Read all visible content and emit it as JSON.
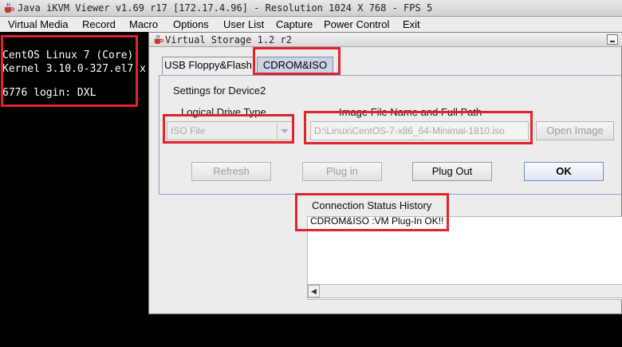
{
  "outer_window": {
    "title": "Java iKVM Viewer v1.69 r17 [172.17.4.96] - Resolution 1024 X 768 - FPS 5",
    "icon": "java-coffee-icon"
  },
  "menubar": {
    "items": [
      "Virtual Media",
      "Record",
      "Macro",
      "Options",
      "User List",
      "Capture",
      "Power Control",
      "Exit"
    ]
  },
  "console": {
    "lines": [
      "CentOS Linux 7 (Core)",
      "Kernel 3.10.0-327.el7.x",
      "6776 login: DXL"
    ]
  },
  "dialog": {
    "title": "Virtual Storage 1.2 r2",
    "tabs": [
      {
        "label": "USB Floppy&Flash",
        "active": false
      },
      {
        "label": "CDROM&ISO",
        "active": true
      }
    ],
    "settings_title": "Settings for Device2",
    "logical_drive_label": "Logical Drive Type",
    "logical_drive_value": "ISO File",
    "image_file_label": "Image File Name and Full Path",
    "image_file_value": "D:\\Linux\\CentOS-7-x86_64-Minimal-1810.iso",
    "open_image_label": "Open Image",
    "buttons": {
      "refresh": "Refresh",
      "plug_in": "Plug in",
      "plug_out": "Plug Out",
      "ok": "OK"
    },
    "status_history_label": "Connection Status History",
    "status_text": "CDROM&ISO :VM Plug-In OK!!"
  },
  "colors": {
    "highlight": "#e0232c",
    "active_tab": "#c9d4e6",
    "dialog_bg": "#ececec"
  }
}
